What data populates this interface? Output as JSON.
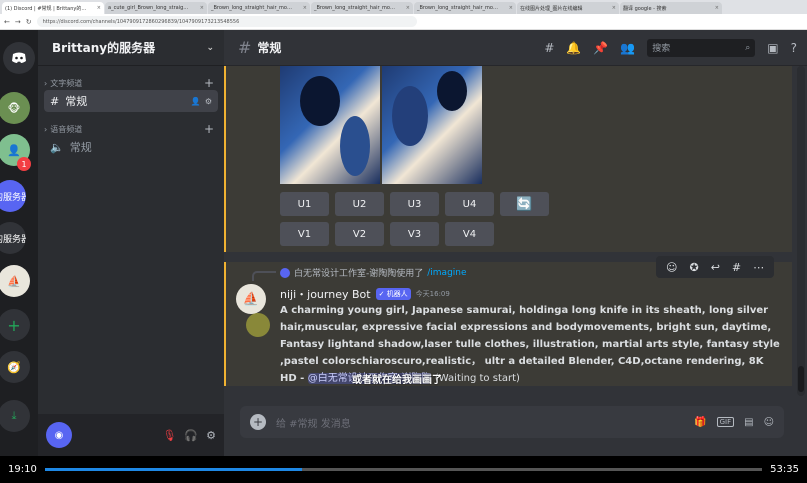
{
  "browser": {
    "tabs": [
      {
        "label": "(1) Discord | #常规 | Brittany的…",
        "active": true
      },
      {
        "label": "a_cute_girl_Brown_long_straig…",
        "active": false
      },
      {
        "label": "_Brown_long_straight_hair_mo…",
        "active": false
      },
      {
        "label": "_Brown_long_straight_hair_mo…",
        "active": false
      },
      {
        "label": "_Brown_long_straight_hair_mo…",
        "active": false
      },
      {
        "label": "在线图片处理_图片在线编辑",
        "active": false
      },
      {
        "label": "翻译 google - 搜索",
        "active": false
      }
    ],
    "url": "https://discord.com/channels/1047909172860296839/1047909173213548556"
  },
  "sidebar": {
    "guild_name": "Brittany的服务器",
    "text_category": "文字频道",
    "voice_category": "语音频道",
    "text_channel": "常规",
    "voice_channel": "常规",
    "badge": "1",
    "server_labels": [
      "的服务器",
      "的服务器"
    ]
  },
  "header": {
    "channel": "常规",
    "search_placeholder": "搜索"
  },
  "buttons": {
    "upscale": [
      "U1",
      "U2",
      "U3",
      "U4"
    ],
    "variation": [
      "V1",
      "V2",
      "V3",
      "V4"
    ],
    "reroll_icon": "🔄"
  },
  "message": {
    "reply_user": "白无常设计工作室-谢陶陶使用了",
    "reply_command": "/imagine",
    "author": "niji・journey Bot",
    "bot_tag": "✓ 机器人",
    "timestamp": "今天16:09",
    "prompt": "A charming young girl, Japanese samurai, holdinga long knife in its sheath, long silver hair,muscular, expressive facial expressions and bodymovements, bright sun, daytime, Fantasy lightand shadow,laser tulle clothes, illustration, martial arts style, fantasy style ,pastel colorschiaroscuro,realistic， ultr a detailed Blender, C4D,octane rendering, 8K HD -",
    "mention": "@白无常设计工作室-谢陶陶",
    "status": "(Waiting to start)",
    "subtitle": "或者就在给我画画了"
  },
  "composer": {
    "placeholder": "给 #常规 发消息",
    "gif": "GIF"
  },
  "player": {
    "elapsed": "19:10",
    "total": "53:35",
    "progress": 0.358
  }
}
